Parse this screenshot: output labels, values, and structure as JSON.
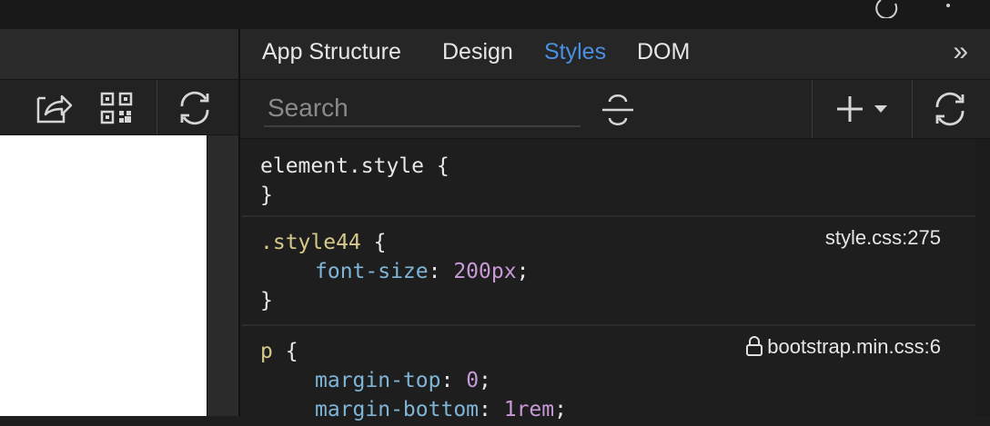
{
  "tabs": [
    {
      "label": "App Structure",
      "active": false
    },
    {
      "label": "Design",
      "active": false
    },
    {
      "label": "Styles",
      "active": true
    },
    {
      "label": "DOM",
      "active": false
    }
  ],
  "more_tabs_glyph": "»",
  "search": {
    "placeholder": "Search",
    "value": ""
  },
  "icons": {
    "left_toolbar": [
      "share-icon",
      "qr-code-icon",
      "refresh-icon"
    ],
    "right_toolbar": [
      "strikethrough-icon",
      "add-icon",
      "dropdown-caret-icon",
      "refresh-icon"
    ]
  },
  "rules": [
    {
      "selector": "element.style",
      "open": " {",
      "close": "}",
      "source": "",
      "declarations": []
    },
    {
      "selector": ".style44",
      "open": " {",
      "close": "}",
      "source": "style.css:275",
      "locked": false,
      "declarations": [
        {
          "prop": "font-size",
          "value": "200px",
          "sep": ": ",
          "end": ";"
        }
      ]
    },
    {
      "selector": "p",
      "open": " {",
      "close": "",
      "source": "bootstrap.min.css:6",
      "locked": true,
      "declarations": [
        {
          "prop": "margin-top",
          "value": "0",
          "sep": ": ",
          "end": ";"
        },
        {
          "prop": "margin-bottom",
          "value": "1rem",
          "sep": ": ",
          "end": ";"
        }
      ]
    }
  ],
  "colors": {
    "active_tab": "#4a90e2",
    "selector": "#d5c98a",
    "property": "#7fb5d6",
    "value": "#c79ad6"
  }
}
